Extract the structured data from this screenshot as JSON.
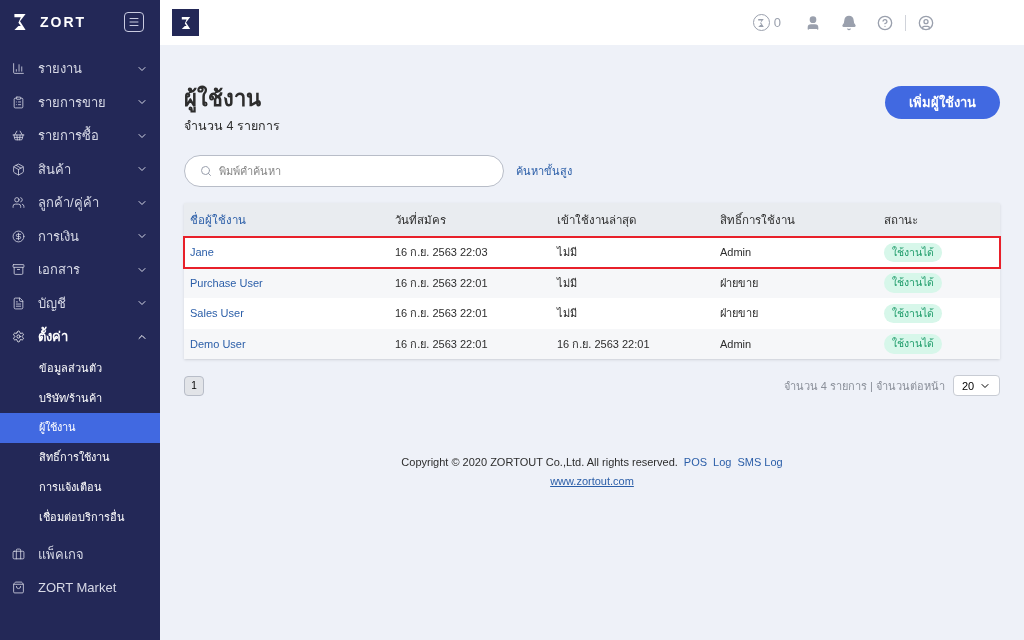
{
  "sidebar": {
    "brand": "ZORT",
    "items": [
      {
        "label": "รายงาน",
        "expanded": false
      },
      {
        "label": "รายการขาย",
        "expanded": false
      },
      {
        "label": "รายการซื้อ",
        "expanded": false
      },
      {
        "label": "สินค้า",
        "expanded": false
      },
      {
        "label": "ลูกค้า/คู่ค้า",
        "expanded": false
      },
      {
        "label": "การเงิน",
        "expanded": false
      },
      {
        "label": "เอกสาร",
        "expanded": false
      },
      {
        "label": "บัญชี",
        "expanded": false
      },
      {
        "label": "ตั้งค่า",
        "expanded": true,
        "children": [
          {
            "label": "ข้อมูลส่วนตัว",
            "selected": false
          },
          {
            "label": "บริษัท/ร้านค้า",
            "selected": false
          },
          {
            "label": "ผู้ใช้งาน",
            "selected": true
          },
          {
            "label": "สิทธิ์การใช้งาน",
            "selected": false
          },
          {
            "label": "การแจ้งเตือน",
            "selected": false
          },
          {
            "label": "เชื่อมต่อบริการอื่น",
            "selected": false
          }
        ]
      }
    ],
    "bottom_items": [
      {
        "label": "แพ็คเกจ"
      },
      {
        "label": "ZORT Market"
      }
    ]
  },
  "topbar": {
    "credit_count": "0"
  },
  "page": {
    "title": "ผู้ใช้งาน",
    "subtitle": "จำนวน 4 รายการ",
    "add_button": "เพิ่มผู้ใช้งาน",
    "search": {
      "placeholder": "พิมพ์คำค้นหา"
    },
    "advanced_search": "ค้นหาขั้นสูง"
  },
  "table": {
    "columns": [
      "ชื่อผู้ใช้งาน",
      "วันที่สมัคร",
      "เข้าใช้งานล่าสุด",
      "สิทธิ์การใช้งาน",
      "สถานะ"
    ],
    "rows": [
      {
        "name": "Jane",
        "registered": "16 ก.ย. 2563 22:03",
        "last_login": "ไม่มี",
        "role": "Admin",
        "status": "ใช้งานได้",
        "highlighted": true
      },
      {
        "name": "Purchase User",
        "registered": "16 ก.ย. 2563 22:01",
        "last_login": "ไม่มี",
        "role": "ฝ่ายขาย",
        "status": "ใช้งานได้",
        "highlighted": false
      },
      {
        "name": "Sales User",
        "registered": "16 ก.ย. 2563 22:01",
        "last_login": "ไม่มี",
        "role": "ฝ่ายขาย",
        "status": "ใช้งานได้",
        "highlighted": false
      },
      {
        "name": "Demo User",
        "registered": "16 ก.ย. 2563 22:01",
        "last_login": "16 ก.ย. 2563 22:01",
        "role": "Admin",
        "status": "ใช้งานได้",
        "highlighted": false
      }
    ]
  },
  "pagination": {
    "pages": [
      {
        "label": "1",
        "selected": true
      }
    ],
    "summary": "จำนวน 4 รายการ | จำนวนต่อหน้า",
    "page_size": "20"
  },
  "footer": {
    "copyright": "Copyright © 2020 ZORTOUT Co.,Ltd. All rights reserved.",
    "links": [
      "POS",
      "Log",
      "SMS Log"
    ],
    "website": "www.zortout.com"
  }
}
